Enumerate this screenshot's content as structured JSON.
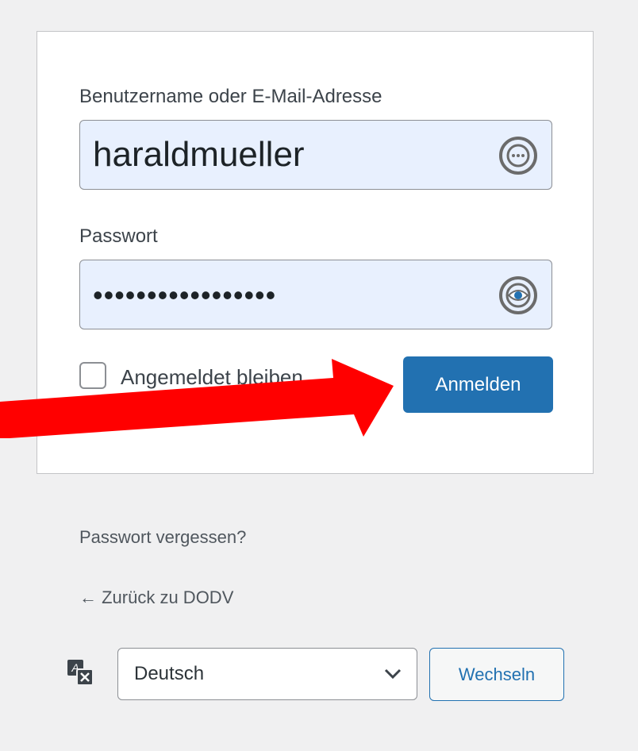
{
  "login_form": {
    "username_label": "Benutzername oder E-Mail-Adresse",
    "username_value": "haraldmueller",
    "username_icon": "password-manager-icon",
    "password_label": "Passwort",
    "password_masked": "•••••••••••••••••",
    "password_icon": "show-password-eye-icon",
    "remember_label": "Angemeldet bleiben",
    "remember_checked": false,
    "submit_label": "Anmelden"
  },
  "links": {
    "lost_password": "Passwort vergessen?",
    "back_to_site": "← Zurück zu DODV"
  },
  "language": {
    "icon": "translate-icon",
    "selected": "Deutsch",
    "switch_label": "Wechseln"
  },
  "annotation": {
    "arrow_color": "#ff0000"
  },
  "colors": {
    "primary": "#2271b1",
    "autofill_bg": "#e8f0fe",
    "page_bg": "#f0f0f1"
  }
}
